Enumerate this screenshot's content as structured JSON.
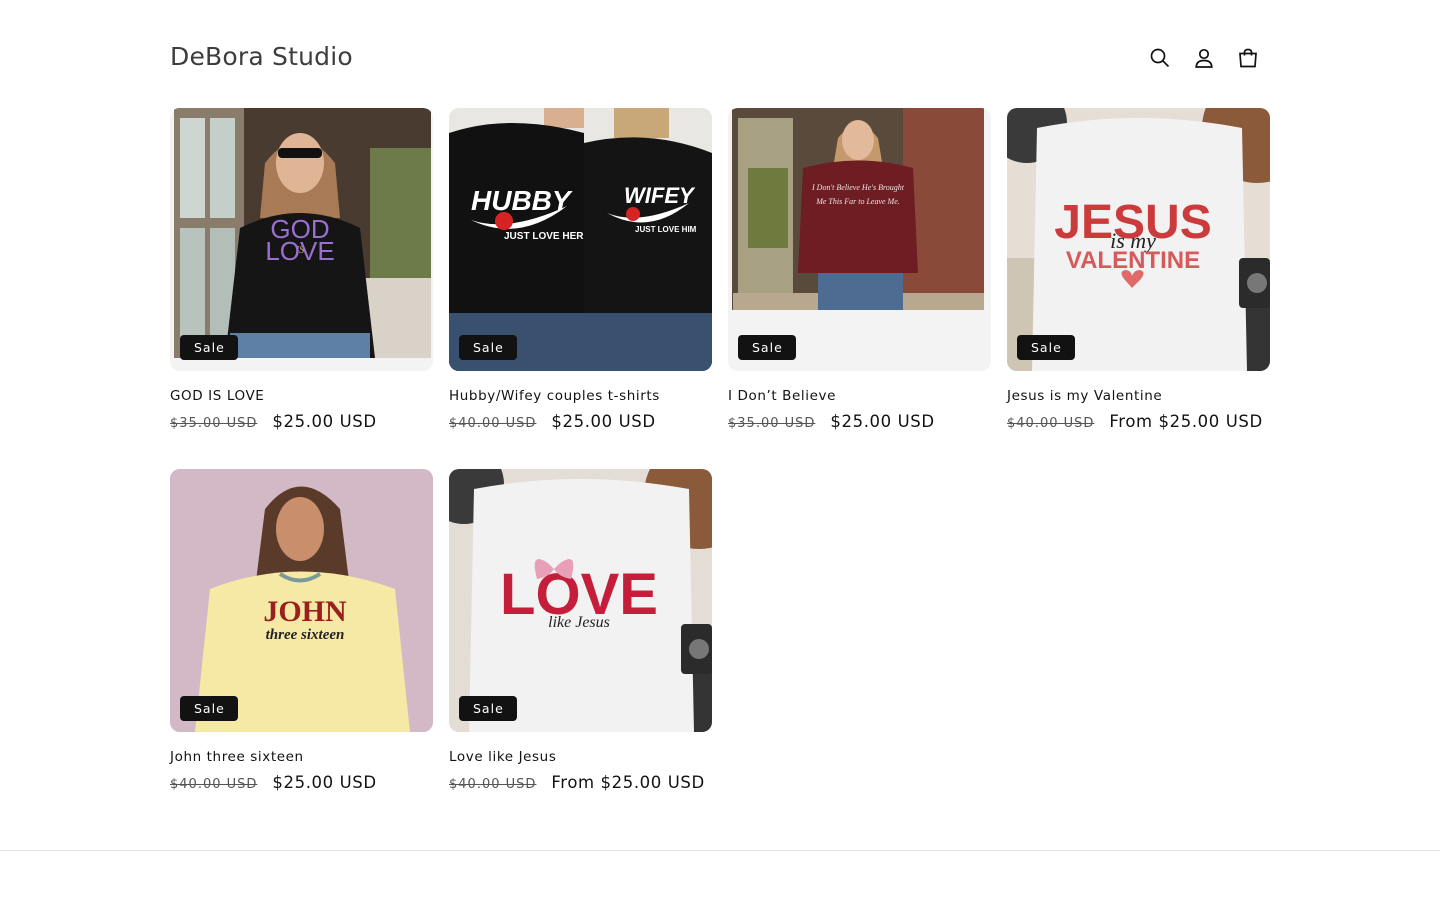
{
  "header": {
    "store_name": "DeBora Studio",
    "icons": [
      "search-icon",
      "account-icon",
      "cart-icon"
    ]
  },
  "products": [
    {
      "title": "GOD IS LOVE",
      "badge": "Sale",
      "compare_price": "$35.00 USD",
      "price": "$25.00 USD",
      "shirt_text": [
        "GOD",
        "IS",
        "LOVE"
      ]
    },
    {
      "title": "Hubby/Wifey couples t-shirts",
      "badge": "Sale",
      "compare_price": "$40.00 USD",
      "price": "$25.00 USD",
      "shirt_text": [
        "HUBBY",
        "JUST LOVE HER",
        "WIFEY",
        "JUST LOVE HIM"
      ]
    },
    {
      "title": "I Don’t Believe",
      "badge": "Sale",
      "compare_price": "$35.00 USD",
      "price": "$25.00 USD",
      "shirt_text": [
        "I Don't Believe He's Brought",
        "Me This Far to Leave Me."
      ]
    },
    {
      "title": "Jesus is my Valentine",
      "badge": "Sale",
      "compare_price": "$40.00 USD",
      "price": "From $25.00 USD",
      "shirt_text": [
        "JESUS",
        "is my",
        "VALENTINE"
      ]
    },
    {
      "title": "John three sixteen",
      "badge": "Sale",
      "compare_price": "$40.00 USD",
      "price": "$25.00 USD",
      "shirt_text": [
        "JOHN",
        "three sixteen"
      ]
    },
    {
      "title": "Love like Jesus",
      "badge": "Sale",
      "compare_price": "$40.00 USD",
      "price": "From $25.00 USD",
      "shirt_text": [
        "LOVE",
        "like Jesus"
      ]
    }
  ]
}
